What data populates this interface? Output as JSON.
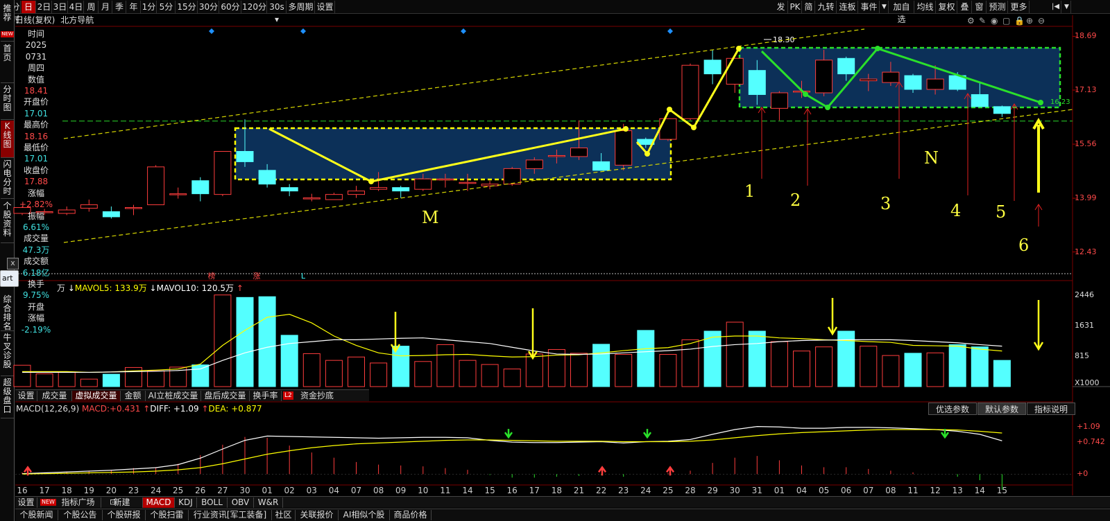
{
  "topbar": {
    "left_tabs": [
      "分时",
      "日",
      "2日",
      "3日",
      "4日",
      "周",
      "月",
      "季",
      "年",
      "1分",
      "5分",
      "15分",
      "30分",
      "60分",
      "120分",
      "30s",
      "多周期",
      "设置"
    ],
    "active_tab": "日",
    "right_tabs": [
      "发",
      "PK",
      "简",
      "九转",
      "连板",
      "事件",
      "加自选",
      "均线",
      "复权",
      "叠",
      "窗",
      "预测",
      "更多"
    ]
  },
  "title": {
    "period": "日线(复权)",
    "stock_name": "北方导航"
  },
  "left_sidebar": {
    "items": [
      "推荐",
      "首页",
      "分时图",
      "K线图",
      "闪电分时",
      "个股资料",
      "综合排名",
      "牛叉诊股",
      "超级盘口"
    ],
    "active": "K线图",
    "new_badge": "NEW"
  },
  "info_panel": {
    "rows": [
      {
        "label": "时间",
        "value": "2025",
        "value2": "0731",
        "color": "#e0e0e0"
      },
      {
        "label": "周四",
        "value": "",
        "color": "#e0e0e0"
      },
      {
        "label": "数值",
        "value": "18.41",
        "color": "#ff4a4a"
      },
      {
        "label": "开盘价",
        "value": "17.01",
        "color": "#40e0e0"
      },
      {
        "label": "最高价",
        "value": "18.16",
        "color": "#ff4a4a"
      },
      {
        "label": "最低价",
        "value": "17.01",
        "color": "#40e0e0"
      },
      {
        "label": "收盘价",
        "value": "17.88",
        "color": "#ff4a4a"
      },
      {
        "label": "涨幅",
        "value": "+2.82%",
        "color": "#ff4a4a"
      },
      {
        "label": "振幅",
        "value": "6.61%",
        "color": "#40e0e0"
      },
      {
        "label": "成交量",
        "value": "47.3万",
        "color": "#40e0e0"
      },
      {
        "label": "成交额",
        "value": "6.18亿",
        "color": "#40e0e0"
      },
      {
        "label": "换手",
        "value": "9.75%",
        "color": "#40e0e0"
      },
      {
        "label": "开盘",
        "value": "",
        "color": "#e0e0e0"
      },
      {
        "label": "涨幅",
        "value": "-2.19%",
        "color": "#40e0e0"
      }
    ]
  },
  "popup": {
    "button_text": "art",
    "close": "x"
  },
  "price_axis": {
    "ticks": [
      "18.69",
      "17.13",
      "15.56",
      "13.99",
      "12.43"
    ]
  },
  "volume_axis": {
    "ticks": [
      "2446",
      "1631",
      "815",
      "X1000"
    ]
  },
  "macd_axis": {
    "ticks": [
      "+1.09",
      "+0.742",
      "+0"
    ]
  },
  "price_labels": {
    "high": "18.30",
    "support": "16.23"
  },
  "markers": {
    "bang": "榜",
    "zhang": "涨",
    "l": "L"
  },
  "volume_header": {
    "unit": "万",
    "mavol5_label": "MAVOL5:",
    "mavol5": "133.9万",
    "mavol10_label": "MAVOL10:",
    "mavol10": "120.5万"
  },
  "volume_tabs": {
    "items": [
      "设置",
      "成交量",
      "虚拟成交量",
      "金额",
      "AI立桩成交量",
      "盘后成交量",
      "换手率",
      "资金抄底"
    ],
    "active": "虚拟成交量",
    "l2": "L2"
  },
  "macd_header": {
    "name": "MACD(12,26,9)",
    "macd_label": "MACD:",
    "macd": "+0.431",
    "diff_label": "DIFF:",
    "diff": "+1.09",
    "dea_label": "DEA:",
    "dea": "+0.877"
  },
  "macd_params": {
    "items": [
      "优选参数",
      "默认参数",
      "指标说明"
    ],
    "active": "默认参数"
  },
  "dates": [
    "16",
    "17",
    "18",
    "19",
    "20",
    "23",
    "24",
    "25",
    "26",
    "27",
    "30",
    "01",
    "02",
    "03",
    "04",
    "07",
    "08",
    "09",
    "10",
    "11",
    "14",
    "15",
    "16",
    "17",
    "18",
    "21",
    "22",
    "23",
    "24",
    "25",
    "28",
    "29",
    "30",
    "31",
    "01",
    "04",
    "05",
    "06",
    "07",
    "08",
    "11",
    "12",
    "13",
    "14",
    "15"
  ],
  "annotations": {
    "M": "M",
    "N": "N",
    "labels": [
      "1",
      "2",
      "3",
      "4",
      "5",
      "6"
    ]
  },
  "bottom_tabs1": {
    "items": [
      "设置",
      "指标广场",
      "新建",
      "MACD",
      "KDJ",
      "BOLL",
      "OBV",
      "W&R"
    ],
    "active": "MACD",
    "new_badge": "NEW"
  },
  "bottom_tabs2": {
    "items": [
      "个股新闻",
      "个股公告",
      "个股研报",
      "个股扫雷",
      "行业资讯[军工装备]",
      "社区",
      "关联报价",
      "AI相似个股",
      "商品价格"
    ]
  },
  "chart_data": {
    "type": "candlestick",
    "price_ylim": [
      11.8,
      18.9
    ],
    "candles": [
      {
        "o": 13.55,
        "h": 13.75,
        "l": 13.5,
        "c": 13.72
      },
      {
        "o": 13.6,
        "h": 13.68,
        "l": 13.5,
        "c": 13.6
      },
      {
        "o": 13.55,
        "h": 13.75,
        "l": 13.5,
        "c": 13.65
      },
      {
        "o": 13.7,
        "h": 13.95,
        "l": 13.6,
        "c": 13.8
      },
      {
        "o": 13.6,
        "h": 13.75,
        "l": 13.4,
        "c": 13.45
      },
      {
        "o": 13.7,
        "h": 13.8,
        "l": 13.5,
        "c": 13.72
      },
      {
        "o": 13.8,
        "h": 14.95,
        "l": 13.8,
        "c": 14.9
      },
      {
        "o": 14.12,
        "h": 14.3,
        "l": 13.98,
        "c": 14.12
      },
      {
        "o": 14.5,
        "h": 14.6,
        "l": 13.9,
        "c": 14.12
      },
      {
        "o": 14.1,
        "h": 15.35,
        "l": 14.05,
        "c": 15.35
      },
      {
        "o": 15.35,
        "h": 16.28,
        "l": 14.9,
        "c": 15.05
      },
      {
        "o": 14.8,
        "h": 14.98,
        "l": 14.3,
        "c": 14.4
      },
      {
        "o": 14.3,
        "h": 14.4,
        "l": 14.05,
        "c": 14.2
      },
      {
        "o": 14.0,
        "h": 14.12,
        "l": 13.9,
        "c": 14.0
      },
      {
        "o": 13.95,
        "h": 14.15,
        "l": 13.95,
        "c": 14.1
      },
      {
        "o": 14.1,
        "h": 14.35,
        "l": 14.0,
        "c": 14.2
      },
      {
        "o": 14.25,
        "h": 14.75,
        "l": 14.2,
        "c": 14.3
      },
      {
        "o": 14.3,
        "h": 14.35,
        "l": 14.0,
        "c": 14.2
      },
      {
        "o": 14.25,
        "h": 14.7,
        "l": 14.2,
        "c": 14.55
      },
      {
        "o": 14.55,
        "h": 14.7,
        "l": 14.3,
        "c": 14.55
      },
      {
        "o": 14.45,
        "h": 14.7,
        "l": 14.2,
        "c": 14.45
      },
      {
        "o": 14.35,
        "h": 14.5,
        "l": 14.25,
        "c": 14.4
      },
      {
        "o": 14.4,
        "h": 14.9,
        "l": 14.35,
        "c": 14.85
      },
      {
        "o": 14.85,
        "h": 15.18,
        "l": 14.7,
        "c": 15.1
      },
      {
        "o": 15.2,
        "h": 15.4,
        "l": 15.0,
        "c": 15.23
      },
      {
        "o": 15.2,
        "h": 16.25,
        "l": 15.1,
        "c": 15.45
      },
      {
        "o": 15.05,
        "h": 15.3,
        "l": 14.85,
        "c": 14.8
      },
      {
        "o": 14.95,
        "h": 16.15,
        "l": 14.8,
        "c": 15.95
      },
      {
        "o": 15.7,
        "h": 15.75,
        "l": 15.45,
        "c": 15.55
      },
      {
        "o": 15.7,
        "h": 16.3,
        "l": 15.65,
        "c": 16.3
      },
      {
        "o": 16.3,
        "h": 17.9,
        "l": 16.25,
        "c": 17.85
      },
      {
        "o": 18.0,
        "h": 18.3,
        "l": 17.3,
        "c": 17.6
      },
      {
        "o": 17.3,
        "h": 18.05,
        "l": 17.05,
        "c": 18.05
      },
      {
        "o": 17.7,
        "h": 18.0,
        "l": 16.7,
        "c": 17.0
      },
      {
        "o": 16.6,
        "h": 17.1,
        "l": 16.25,
        "c": 17.05
      },
      {
        "o": 17.1,
        "h": 17.4,
        "l": 16.9,
        "c": 17.1
      },
      {
        "o": 17.05,
        "h": 18.3,
        "l": 16.95,
        "c": 18.0
      },
      {
        "o": 18.05,
        "h": 18.1,
        "l": 17.4,
        "c": 17.6
      },
      {
        "o": 17.4,
        "h": 17.6,
        "l": 17.1,
        "c": 17.45
      },
      {
        "o": 17.35,
        "h": 17.95,
        "l": 17.25,
        "c": 17.65
      },
      {
        "o": 17.55,
        "h": 17.6,
        "l": 17.05,
        "c": 17.15
      },
      {
        "o": 17.15,
        "h": 17.85,
        "l": 17.0,
        "c": 17.45
      },
      {
        "o": 17.55,
        "h": 17.65,
        "l": 17.1,
        "c": 17.15
      },
      {
        "o": 17.0,
        "h": 17.35,
        "l": 16.9,
        "c": 16.65
      },
      {
        "o": 16.65,
        "h": 16.68,
        "l": 16.35,
        "c": 16.45
      }
    ],
    "volume_ylim": [
      0,
      2700
    ],
    "volume": [
      570,
      340,
      380,
      200,
      330,
      510,
      420,
      520,
      580,
      2446,
      2380,
      2400,
      1370,
      880,
      700,
      790,
      630,
      1080,
      670,
      1120,
      700,
      590,
      470,
      870,
      990,
      890,
      1130,
      860,
      1500,
      860,
      1250,
      1480,
      1720,
      1480,
      1200,
      950,
      1060,
      1480,
      1080,
      830,
      890,
      900,
      1120,
      1060,
      700
    ],
    "mavol5": [
      400,
      400,
      400,
      380,
      390,
      420,
      440,
      470,
      600,
      1100,
      1500,
      1850,
      1930,
      1700,
      1350,
      1100,
      900,
      820,
      830,
      850,
      860,
      820,
      790,
      800,
      840,
      850,
      900,
      960,
      1010,
      1040,
      1150,
      1320,
      1350,
      1350,
      1300,
      1280,
      1250,
      1230,
      1200,
      1180,
      1100,
      1090,
      1080,
      1000,
      950
    ],
    "mavol10": [
      380,
      380,
      380,
      380,
      390,
      400,
      410,
      430,
      470,
      700,
      900,
      1050,
      1150,
      1200,
      1250,
      1250,
      1270,
      1290,
      1300,
      1250,
      1200,
      1150,
      1050,
      950,
      870,
      860,
      870,
      900,
      930,
      960,
      1000,
      1070,
      1120,
      1150,
      1200,
      1230,
      1240,
      1250,
      1250,
      1250,
      1230,
      1200,
      1170,
      1120,
      1080
    ],
    "macd_ylim": [
      -0.25,
      1.35
    ],
    "diff": [
      0.01,
      0.03,
      0.05,
      0.07,
      0.09,
      0.12,
      0.15,
      0.22,
      0.37,
      0.58,
      0.78,
      0.88,
      0.87,
      0.86,
      0.85,
      0.84,
      0.83,
      0.84,
      0.85,
      0.85,
      0.84,
      0.78,
      0.74,
      0.73,
      0.73,
      0.74,
      0.75,
      0.72,
      0.75,
      0.76,
      0.8,
      0.92,
      1.03,
      1.1,
      1.09,
      1.06,
      1.06,
      1.08,
      1.08,
      1.07,
      1.05,
      1.03,
      0.99,
      0.92,
      0.77
    ],
    "dea": [
      0.0,
      0.01,
      0.02,
      0.03,
      0.04,
      0.05,
      0.07,
      0.1,
      0.15,
      0.24,
      0.35,
      0.46,
      0.54,
      0.61,
      0.66,
      0.7,
      0.72,
      0.74,
      0.76,
      0.78,
      0.79,
      0.79,
      0.78,
      0.77,
      0.76,
      0.76,
      0.76,
      0.75,
      0.75,
      0.75,
      0.76,
      0.79,
      0.84,
      0.89,
      0.93,
      0.96,
      0.98,
      1.0,
      1.02,
      1.03,
      1.03,
      1.03,
      1.02,
      0.99,
      0.95
    ],
    "macd_hist": [
      0.04,
      0.04,
      0.06,
      0.08,
      0.1,
      0.14,
      0.16,
      0.24,
      0.44,
      0.68,
      0.86,
      0.84,
      0.66,
      0.5,
      0.38,
      0.28,
      0.22,
      0.2,
      0.18,
      0.14,
      0.1,
      -0.02,
      -0.08,
      -0.08,
      -0.06,
      -0.04,
      -0.02,
      -0.06,
      0.0,
      0.02,
      0.08,
      0.26,
      0.38,
      0.42,
      0.32,
      0.2,
      0.16,
      0.16,
      0.12,
      0.08,
      0.04,
      0.0,
      -0.06,
      -0.14,
      -0.36
    ]
  }
}
